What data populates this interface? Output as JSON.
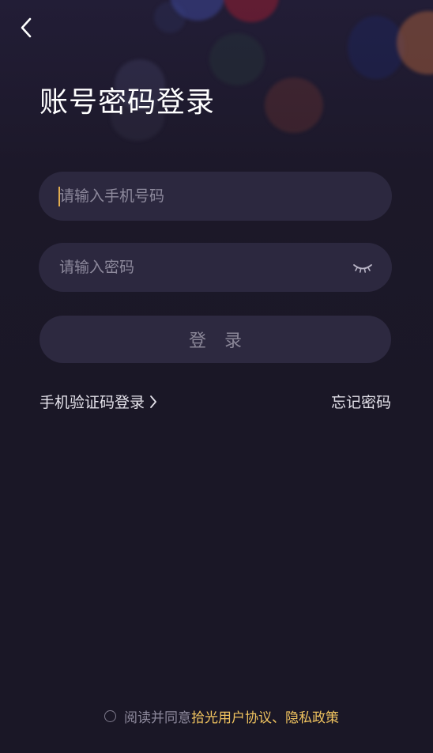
{
  "header": {
    "back_icon": "chevron-left-icon",
    "title": "账号密码登录"
  },
  "form": {
    "phone_placeholder": "请输入手机号码",
    "phone_value": "",
    "password_placeholder": "请输入密码",
    "password_value": "",
    "password_toggle_icon": "eye-closed-icon",
    "login_label": "登 录"
  },
  "links": {
    "sms_login": "手机验证码登录",
    "sms_login_icon": "chevron-right-icon",
    "forgot_password": "忘记密码"
  },
  "agreement": {
    "checked": false,
    "prefix": "阅读并同意",
    "user_agreement": "拾光用户协议",
    "separator": "、",
    "privacy_policy": "隐私政策"
  },
  "colors": {
    "background": "#1a1726",
    "input_background": "#2c283f",
    "accent": "#f0c35f",
    "caret": "#e2ad4f",
    "muted_text": "#8d899c"
  }
}
